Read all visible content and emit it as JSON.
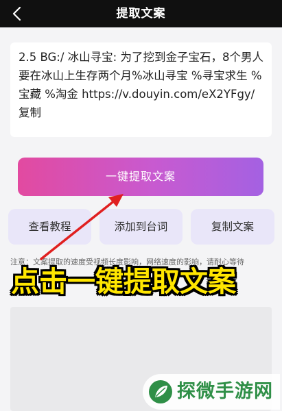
{
  "header": {
    "back_icon": "chevron-left-icon",
    "title": "提取文案"
  },
  "input_text": "2.5 BG:/ 冰山寻宝: 为了挖到金子宝石，8个男人要在冰山上生存两个月%冰山寻宝 %寻宝求生 %宝藏 %淘金 https://v.douyin.com/eX2YFgy/ 复制",
  "buttons": {
    "extract": "一键提取文案",
    "tutorial": "查看教程",
    "add_to_script": "添加到台词",
    "copy_text": "复制文案"
  },
  "notice": "注意：文案提取的速度受视频长度影响，网络速度的影响，请耐心等待",
  "caption": "点击一键提取文案",
  "watermark": {
    "text": "探微手游网",
    "logo_icon": "leaf-logo-icon"
  },
  "colors": {
    "header_bg": "#101010",
    "extract_gradient_start": "#e24aa0",
    "extract_gradient_end": "#a461e2",
    "sub_button_bg": "#e9e6f9",
    "caption_color": "#ffe600",
    "arrow_color": "#e02020",
    "watermark_color": "#2f8f47"
  }
}
